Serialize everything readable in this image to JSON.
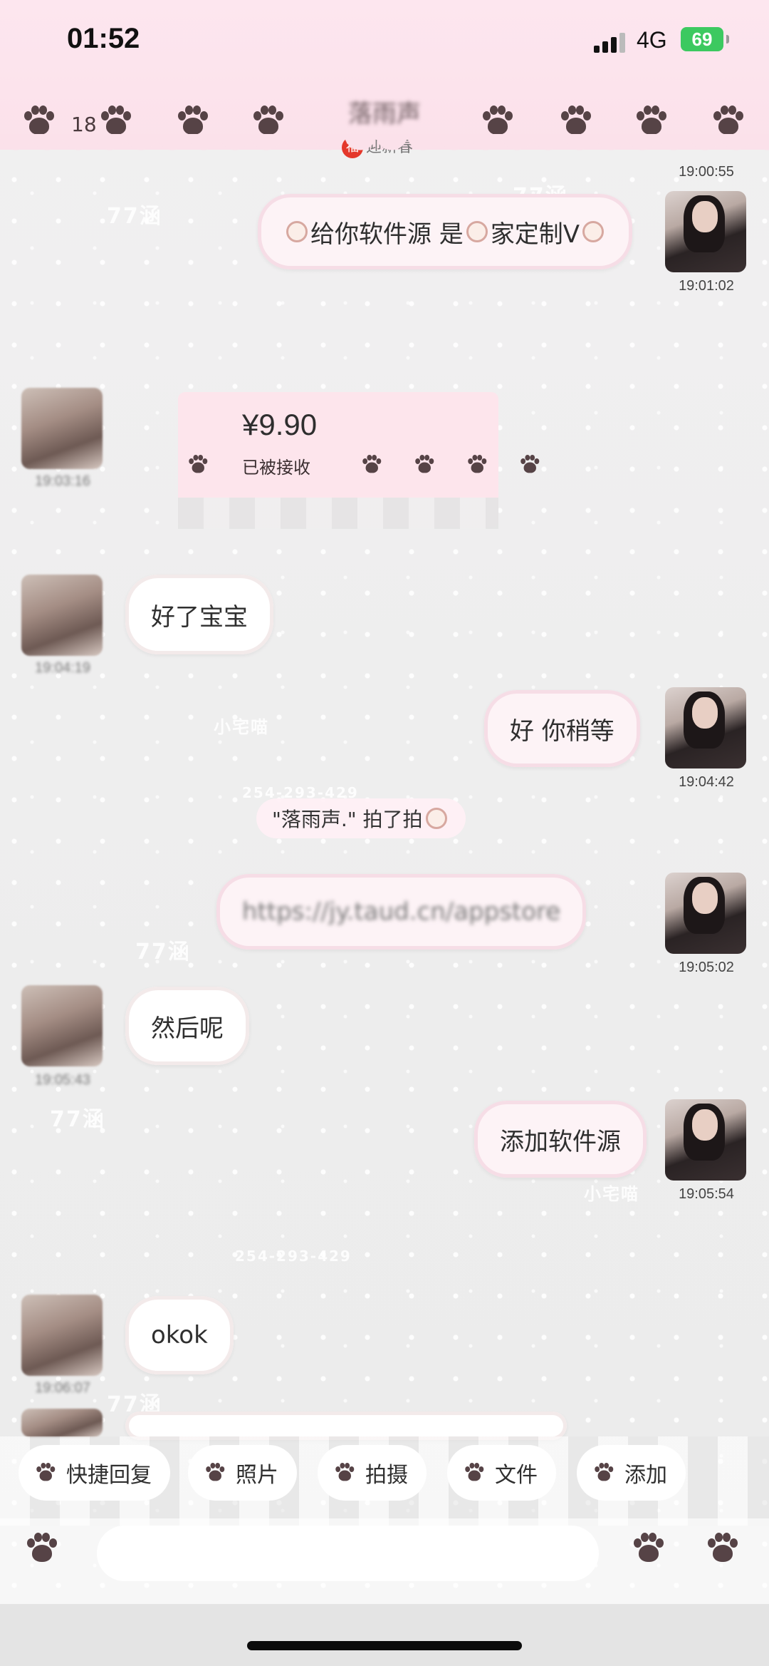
{
  "status": {
    "time": "01:52",
    "network": "4G",
    "battery": "69"
  },
  "header": {
    "back_count": "18",
    "title": "落雨声",
    "subtitle": "迎新春",
    "fu": "福"
  },
  "watermarks": [
    "77涵",
    "小宅喵",
    "254-293-429"
  ],
  "messages": [
    {
      "side": "right",
      "text_pre": "给你软件源  是",
      "text_post": "家定制V",
      "time": "19:01:02"
    },
    {
      "side": "left",
      "kind": "transfer",
      "amount": "¥9.90",
      "status": "已被接收",
      "time": "19:03:16"
    },
    {
      "side": "left",
      "text": "好了宝宝",
      "time": "19:04:19"
    },
    {
      "side": "right",
      "text": "好  你稍等",
      "time": "19:04:42"
    },
    {
      "side": "system",
      "text": "\"落雨声.\" 拍了拍"
    },
    {
      "side": "right",
      "text": "https://jy.taud.cn/appstore",
      "time": "19:05:02"
    },
    {
      "side": "left",
      "text": "然后呢",
      "time": "19:05:43"
    },
    {
      "side": "right",
      "text": "添加软件源",
      "time": "19:05:54"
    },
    {
      "side": "left",
      "text": "okok",
      "time": "19:06:07"
    }
  ],
  "top_partial_time": "19:00:55",
  "quick_actions": [
    "快捷回复",
    "照片",
    "拍摄",
    "文件",
    "添加"
  ],
  "input": {
    "placeholder": ""
  },
  "colors": {
    "header_pink": "#fbe1ea",
    "paw": "#564346",
    "bubble_border_pink": "#f6dde6",
    "battery_green": "#3cc960"
  }
}
